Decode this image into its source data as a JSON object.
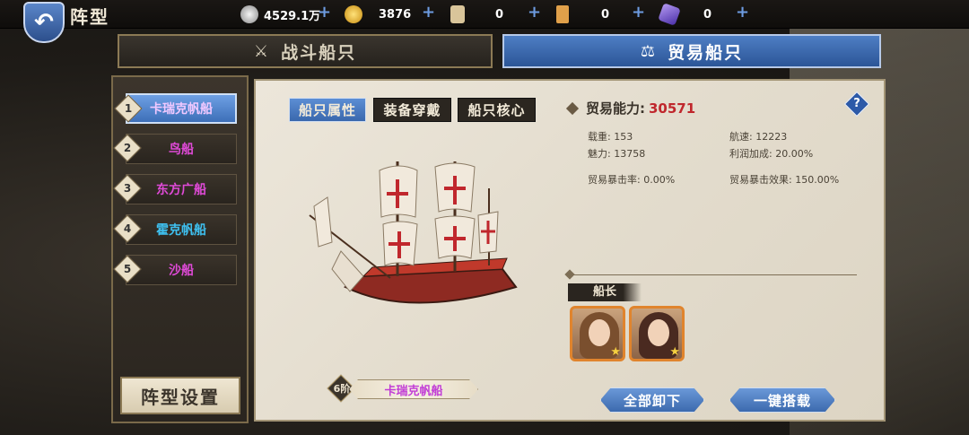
{
  "header": {
    "title": "阵型",
    "back_icon": "back-arrow-icon"
  },
  "resources": [
    {
      "name": "silver",
      "value": "4529.1万",
      "color": "#c8c8c8"
    },
    {
      "name": "gold",
      "value": "3876",
      "color": "#f2c230"
    },
    {
      "name": "scroll",
      "value": "0",
      "color": "#d9c59a"
    },
    {
      "name": "card",
      "value": "0",
      "color": "#e0a04a"
    },
    {
      "name": "gem",
      "value": "0",
      "color": "#7a5bd6"
    }
  ],
  "tabs": {
    "battle": "战斗船只",
    "trade": "贸易船只"
  },
  "ships": [
    {
      "num": "1",
      "name": "卡瑞克帆船",
      "color": "#f0c8ff",
      "selected": true
    },
    {
      "num": "2",
      "name": "鸟船",
      "color": "#e04ad8"
    },
    {
      "num": "3",
      "name": "东方广船",
      "color": "#e04ad8"
    },
    {
      "num": "4",
      "name": "霍克帆船",
      "color": "#3ec0f0"
    },
    {
      "num": "5",
      "name": "沙船",
      "color": "#e04ad8"
    }
  ],
  "formation_button": "阵型设置",
  "sub_tabs": [
    "船只属性",
    "装备穿戴",
    "船只核心"
  ],
  "stats": {
    "power_label": "贸易能力:",
    "power_value": "30571",
    "load": "载重: 153",
    "speed": "航速: 12223",
    "charm": "魅力: 13758",
    "profit": "利润加成: 20.00%",
    "crit_rate": "贸易暴击率: 0.00%",
    "crit_effect": "贸易暴击效果: 150.00%"
  },
  "captain_label": "船长",
  "ship_rank": "6阶",
  "ship_name": "卡瑞克帆船",
  "buttons": {
    "unload_all": "全部卸下",
    "auto_load": "一键搭载"
  },
  "colors": {
    "accent_blue": "#4e7ec4",
    "power_red": "#c0272d",
    "ship_name_purple": "#c13bd6"
  }
}
